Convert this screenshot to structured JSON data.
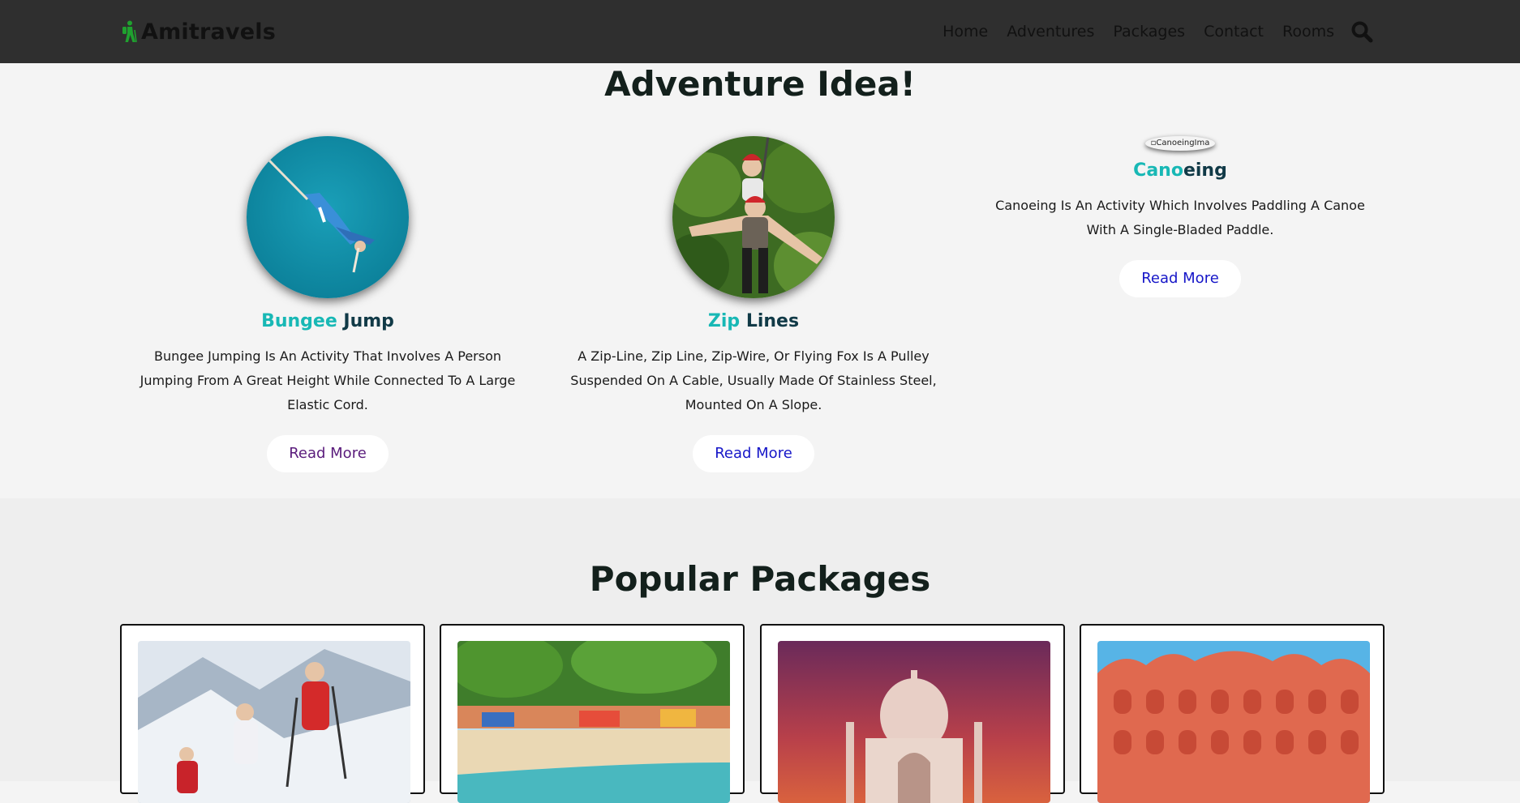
{
  "brand": {
    "name": "Amitravels",
    "accent": "#1fa12f"
  },
  "nav": {
    "items": [
      "Home",
      "Adventures",
      "Packages",
      "Contact",
      "Rooms"
    ],
    "search_icon": "search-icon"
  },
  "adventures": {
    "heading": "Adventure Idea!",
    "cards": [
      {
        "title_accent": "Bungee",
        "title_rest": " Jump",
        "description": "Bungee Jumping Is An Activity That Involves A Person Jumping From A Great Height While Connected To A Large Elastic Cord.",
        "button": "Read More"
      },
      {
        "title_accent": "Zip",
        "title_rest": " Lines",
        "description": "A Zip-Line, Zip Line, Zip-Wire, Or Flying Fox Is A Pulley Suspended On A Cable, Usually Made Of Stainless Steel, Mounted On A Slope.",
        "button": "Read More"
      },
      {
        "image_alt": "CanoeingIma",
        "title_accent": "Cano",
        "title_rest": "eing",
        "description": "Canoeing Is An Activity Which Involves Paddling A Canoe With A Single-Bladed Paddle.",
        "button": "Read More"
      }
    ]
  },
  "packages": {
    "heading": "Popular Packages"
  },
  "colors": {
    "navbar_bg": "#2f2f2f",
    "title_accent": "#18b8b5",
    "title_dark": "#113a47",
    "link_blue": "#1616c8",
    "link_visited": "#5a1c7c"
  }
}
